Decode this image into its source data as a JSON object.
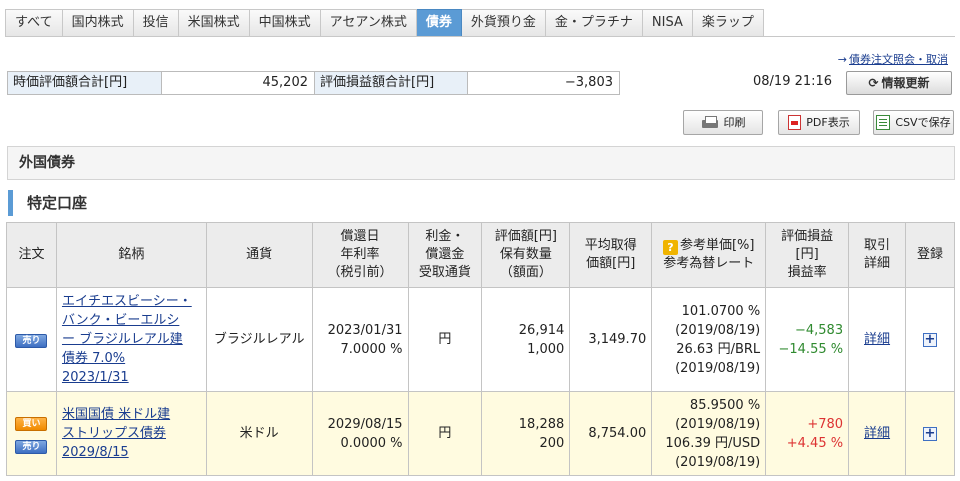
{
  "tabs": [
    {
      "label": "すべて",
      "active": false
    },
    {
      "label": "国内株式",
      "active": false
    },
    {
      "label": "投信",
      "active": false
    },
    {
      "label": "米国株式",
      "active": false
    },
    {
      "label": "中国株式",
      "active": false
    },
    {
      "label": "アセアン株式",
      "active": false
    },
    {
      "label": "債券",
      "active": true
    },
    {
      "label": "外貨預り金",
      "active": false
    },
    {
      "label": "金・プラチナ",
      "active": false
    },
    {
      "label": "NISA",
      "active": false
    },
    {
      "label": "楽ラップ",
      "active": false
    }
  ],
  "top_link": "債券注文照会・取消",
  "summary": {
    "valuation_label": "時価評価額合計[円]",
    "valuation_value": "45,202",
    "pl_label": "評価損益額合計[円]",
    "pl_value": "−3,803"
  },
  "timestamp": "08/19 21:16",
  "refresh_label": "情報更新",
  "toolbar": {
    "print_label": "印刷",
    "pdf_label": "PDF表示",
    "csv_label": "CSVで保存"
  },
  "section_title": "外国債券",
  "account_title": "特定口座",
  "columns": {
    "order": "注文",
    "name": "銘柄",
    "currency": "通貨",
    "redemption_l1": "償還日",
    "redemption_l2": "年利率",
    "redemption_l3": "（税引前）",
    "interest_l1": "利金・",
    "interest_l2": "償還金",
    "interest_l3": "受取通貨",
    "value_l1": "評価額[円]",
    "value_l2": "保有数量",
    "value_l3": "（額面）",
    "avg_l1": "平均取得",
    "avg_l2": "価額[円]",
    "ref_l1": "参考単価[%]",
    "ref_l2": "参考為替レート",
    "pl_l1": "評価損益",
    "pl_l2": "[円]",
    "pl_l3": "損益率",
    "trade_l1": "取引",
    "trade_l2": "詳細",
    "register": "登録"
  },
  "rows": [
    {
      "buy_label": "",
      "sell_label": "売り",
      "name_l1": "エイチエスビーシー・",
      "name_l2": "バンク・ビーエルシ",
      "name_l3": "ー ブラジルレアル建",
      "name_l4": "債券 7.0%",
      "name_l5": "2023/1/31",
      "currency": "ブラジルレアル",
      "redemption_date": "2023/01/31",
      "rate": "7.0000 %",
      "receive_currency": "円",
      "value": "26,914",
      "quantity": "1,000",
      "avg_price": "3,149.70",
      "ref_price": "101.0700 %",
      "ref_price_date": "(2019/08/19)",
      "fx_rate": "26.63 円/BRL",
      "fx_date": "(2019/08/19)",
      "pl": "−4,583",
      "pl_rate": "−14.55 %",
      "detail_label": "詳細"
    },
    {
      "buy_label": "買い",
      "sell_label": "売り",
      "name_l1": "米国国債 米ドル建",
      "name_l2": "ストリップス債券",
      "name_l3": "2029/8/15",
      "name_l4": "",
      "name_l5": "",
      "currency": "米ドル",
      "redemption_date": "2029/08/15",
      "rate": "0.0000 %",
      "receive_currency": "円",
      "value": "18,288",
      "quantity": "200",
      "avg_price": "8,754.00",
      "ref_price": "85.9500 %",
      "ref_price_date": "(2019/08/19)",
      "fx_rate": "106.39 円/USD",
      "fx_date": "(2019/08/19)",
      "pl": "+780",
      "pl_rate": "+4.45 %",
      "detail_label": "詳細"
    }
  ]
}
